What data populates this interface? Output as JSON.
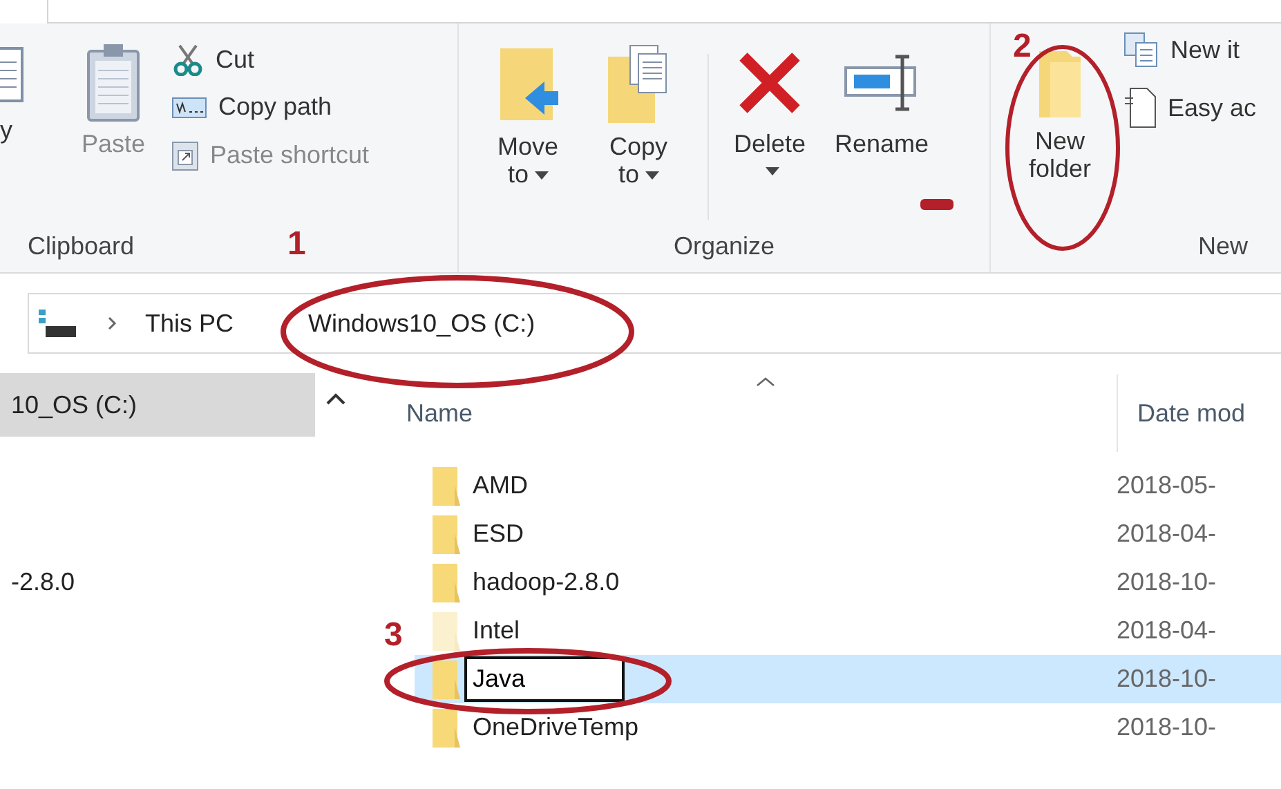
{
  "ribbon": {
    "clipboard": {
      "label": "Clipboard",
      "copy": {
        "label": "y",
        "disabled": false
      },
      "paste": {
        "label": "Paste",
        "disabled": true
      },
      "cut": {
        "label": "Cut",
        "disabled": false
      },
      "copy_path": {
        "label": "Copy path",
        "disabled": false
      },
      "paste_shortcut": {
        "label": "Paste shortcut",
        "disabled": true
      }
    },
    "organize": {
      "label": "Organize",
      "move_to": {
        "label": "Move to",
        "disabled": false
      },
      "copy_to": {
        "label": "Copy to",
        "disabled": false
      },
      "delete": {
        "label": "Delete",
        "disabled": false
      },
      "rename": {
        "label": "Rename",
        "disabled": false
      }
    },
    "new": {
      "label": "New",
      "new_folder": {
        "label": "New folder",
        "disabled": false
      },
      "new_item": {
        "label": "New it",
        "disabled": false
      },
      "easy_access": {
        "label": "Easy ac",
        "disabled": false
      }
    }
  },
  "address_bar": {
    "crumbs": [
      "This PC",
      "Windows10_OS (C:)"
    ]
  },
  "sidebar": {
    "items": [
      {
        "label": "10_OS (C:)",
        "selected": true
      },
      {
        "label": "-2.8.0",
        "selected": false
      }
    ]
  },
  "table": {
    "columns": [
      "Name",
      "Date mod"
    ],
    "rows": [
      {
        "name": "AMD",
        "date": "2018-05-",
        "hidden": false,
        "selected": false,
        "renaming": false
      },
      {
        "name": "ESD",
        "date": "2018-04-",
        "hidden": false,
        "selected": false,
        "renaming": false
      },
      {
        "name": "hadoop-2.8.0",
        "date": "2018-10-",
        "hidden": false,
        "selected": false,
        "renaming": false
      },
      {
        "name": "Intel",
        "date": "2018-04-",
        "hidden": true,
        "selected": false,
        "renaming": false
      },
      {
        "name": "Java",
        "date": "2018-10-",
        "hidden": false,
        "selected": true,
        "renaming": true
      },
      {
        "name": "OneDriveTemp",
        "date": "2018-10-",
        "hidden": false,
        "selected": false,
        "renaming": false
      }
    ]
  },
  "annotations": [
    {
      "label": "1"
    },
    {
      "label": "2"
    },
    {
      "label": "3"
    }
  ]
}
